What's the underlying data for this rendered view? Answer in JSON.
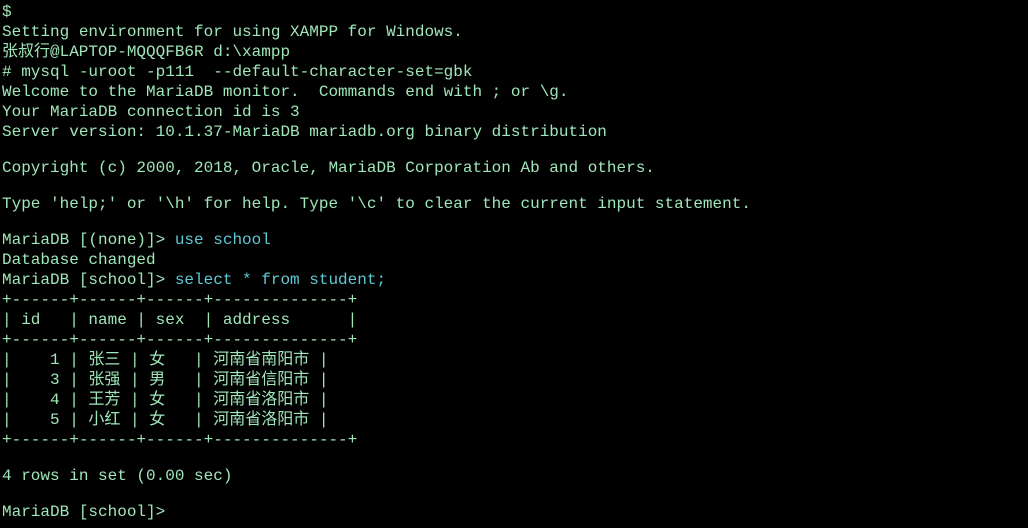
{
  "pre": {
    "dollar": "$",
    "l0": "Setting environment for using XAMPP for Windows.",
    "l1": "张叔行@LAPTOP-MQQQFB6R d:\\xampp",
    "l2": "# mysql -uroot -p111  --default-character-set=gbk",
    "l3": "Welcome to the MariaDB monitor.  Commands end with ; or \\g.",
    "l4": "Your MariaDB connection id is 3",
    "l5": "Server version: 10.1.37-MariaDB mariadb.org binary distribution",
    "l6": "Copyright (c) 2000, 2018, Oracle, MariaDB Corporation Ab and others.",
    "l7": "Type 'help;' or '\\h' for help. Type '\\c' to clear the current input statement."
  },
  "prompt1": {
    "text": "MariaDB [(none)]> ",
    "cmd": "use school"
  },
  "dbchanged": "Database changed",
  "prompt2": {
    "text": "MariaDB [school]> ",
    "cmd": "select * from student;"
  },
  "table": {
    "border": "+------+------+------+--------------+",
    "header": "| id   | name | sex  | address      |",
    "rows": [
      "|    1 | 张三 | 女   | 河南省南阳市 |",
      "|    3 | 张强 | 男   | 河南省信阳市 |",
      "|    4 | 王芳 | 女   | 河南省洛阳市 |",
      "|    5 | 小红 | 女   | 河南省洛阳市 |"
    ]
  },
  "result": "4 rows in set (0.00 sec)",
  "prompt3": {
    "text": "MariaDB [school]> "
  },
  "chart_data": {
    "type": "table",
    "columns": [
      "id",
      "name",
      "sex",
      "address"
    ],
    "rows": [
      [
        1,
        "张三",
        "女",
        "河南省南阳市"
      ],
      [
        3,
        "张强",
        "男",
        "河南省信阳市"
      ],
      [
        4,
        "王芳",
        "女",
        "河南省洛阳市"
      ],
      [
        5,
        "小红",
        "女",
        "河南省洛阳市"
      ]
    ],
    "row_count": 4,
    "elapsed": "0.00 sec"
  }
}
